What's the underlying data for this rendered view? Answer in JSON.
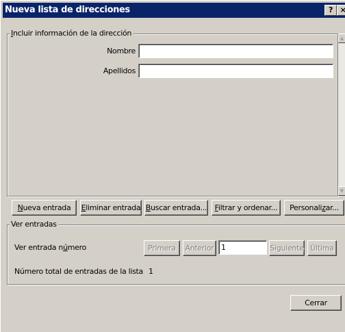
{
  "window": {
    "title": "Nueva lista de direcciones",
    "help_button": "?",
    "close_button": "×"
  },
  "address_info": {
    "legend_prefix": "I",
    "legend_rest": "ncluir información de la dirección",
    "fields": [
      {
        "label": "Nombre",
        "value": ""
      },
      {
        "label": "Apellidos",
        "value": ""
      }
    ]
  },
  "buttons": {
    "new_entry": {
      "u": "N",
      "rest": "ueva entrada"
    },
    "delete_entry": {
      "u": "E",
      "rest": "liminar entrada"
    },
    "find_entry": {
      "u": "B",
      "rest": "uscar entrada..."
    },
    "filter_sort": {
      "u": "F",
      "rest": "iltrar y ordenar..."
    },
    "customize": {
      "pre": "Personali",
      "u": "z",
      "rest": "ar..."
    }
  },
  "view_entries": {
    "legend": "Ver entradas",
    "entry_number_label_pre": "Ver entrada n",
    "entry_number_label_u": "ú",
    "entry_number_label_post": "mero",
    "first": "Primera",
    "previous": "Anterior",
    "current_entry": "1",
    "next": "Siguiente",
    "last": "Última",
    "total_label": "Número total de entradas de la lista",
    "total_value": "1"
  },
  "close": "Cerrar"
}
